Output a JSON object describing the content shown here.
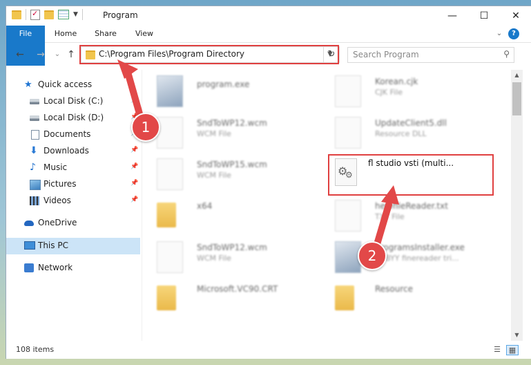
{
  "window": {
    "title": "Program",
    "controls": {
      "minimize": "—",
      "maximize": "☐",
      "close": "✕"
    }
  },
  "ribbon": {
    "tabs": [
      "File",
      "Home",
      "Share",
      "View"
    ],
    "expand_icon": "chevron-down",
    "help_label": "?"
  },
  "nav": {
    "back": "←",
    "forward": "→",
    "up": "↑",
    "recent": "⌄",
    "address": "C:\\Program Files\\Program Directory",
    "search_placeholder": "Search Program"
  },
  "sidebar": {
    "items": [
      {
        "label": "Quick access",
        "icon": "star-icon",
        "pinned": false
      },
      {
        "label": "Local Disk (C:)",
        "icon": "drive-icon",
        "pinned": true
      },
      {
        "label": "Local Disk (D:)",
        "icon": "drive-icon",
        "pinned": true
      },
      {
        "label": "Documents",
        "icon": "documents-icon",
        "pinned": true
      },
      {
        "label": "Downloads",
        "icon": "download-icon",
        "pinned": true
      },
      {
        "label": "Music",
        "icon": "music-icon",
        "pinned": true
      },
      {
        "label": "Pictures",
        "icon": "pictures-icon",
        "pinned": true
      },
      {
        "label": "Videos",
        "icon": "videos-icon",
        "pinned": true
      },
      {
        "label": "OneDrive",
        "icon": "cloud-icon",
        "pinned": false
      },
      {
        "label": "This PC",
        "icon": "computer-icon",
        "pinned": false,
        "selected": true
      },
      {
        "label": "Network",
        "icon": "network-icon",
        "pinned": false
      }
    ]
  },
  "files": [
    {
      "name": "program.exe",
      "type": ""
    },
    {
      "name": "Korean.cjk",
      "type": "CJK File"
    },
    {
      "name": "SndToWP12.wcm",
      "type": "WCM File"
    },
    {
      "name": "UpdateClient5.dll",
      "type": "Resource DLL"
    },
    {
      "name": "SndToWP15.wcm",
      "type": "WCM File"
    },
    {
      "name": "fl studio vsti (multi...",
      "type": ""
    },
    {
      "name": "x64",
      "type": ""
    },
    {
      "name": "helpfileReader.txt",
      "type": "TXT File"
    },
    {
      "name": "SndToWP12.wcm",
      "type": "WCM File"
    },
    {
      "name": "programsInstaller.exe",
      "type": "ABBYY finereader tri..."
    },
    {
      "name": "Microsoft.VC90.CRT",
      "type": ""
    },
    {
      "name": "Resource",
      "type": ""
    }
  ],
  "status": {
    "item_count": "108 items"
  },
  "annotations": {
    "marker_1": "1",
    "marker_2": "2",
    "highlight_color": "#e04040"
  }
}
